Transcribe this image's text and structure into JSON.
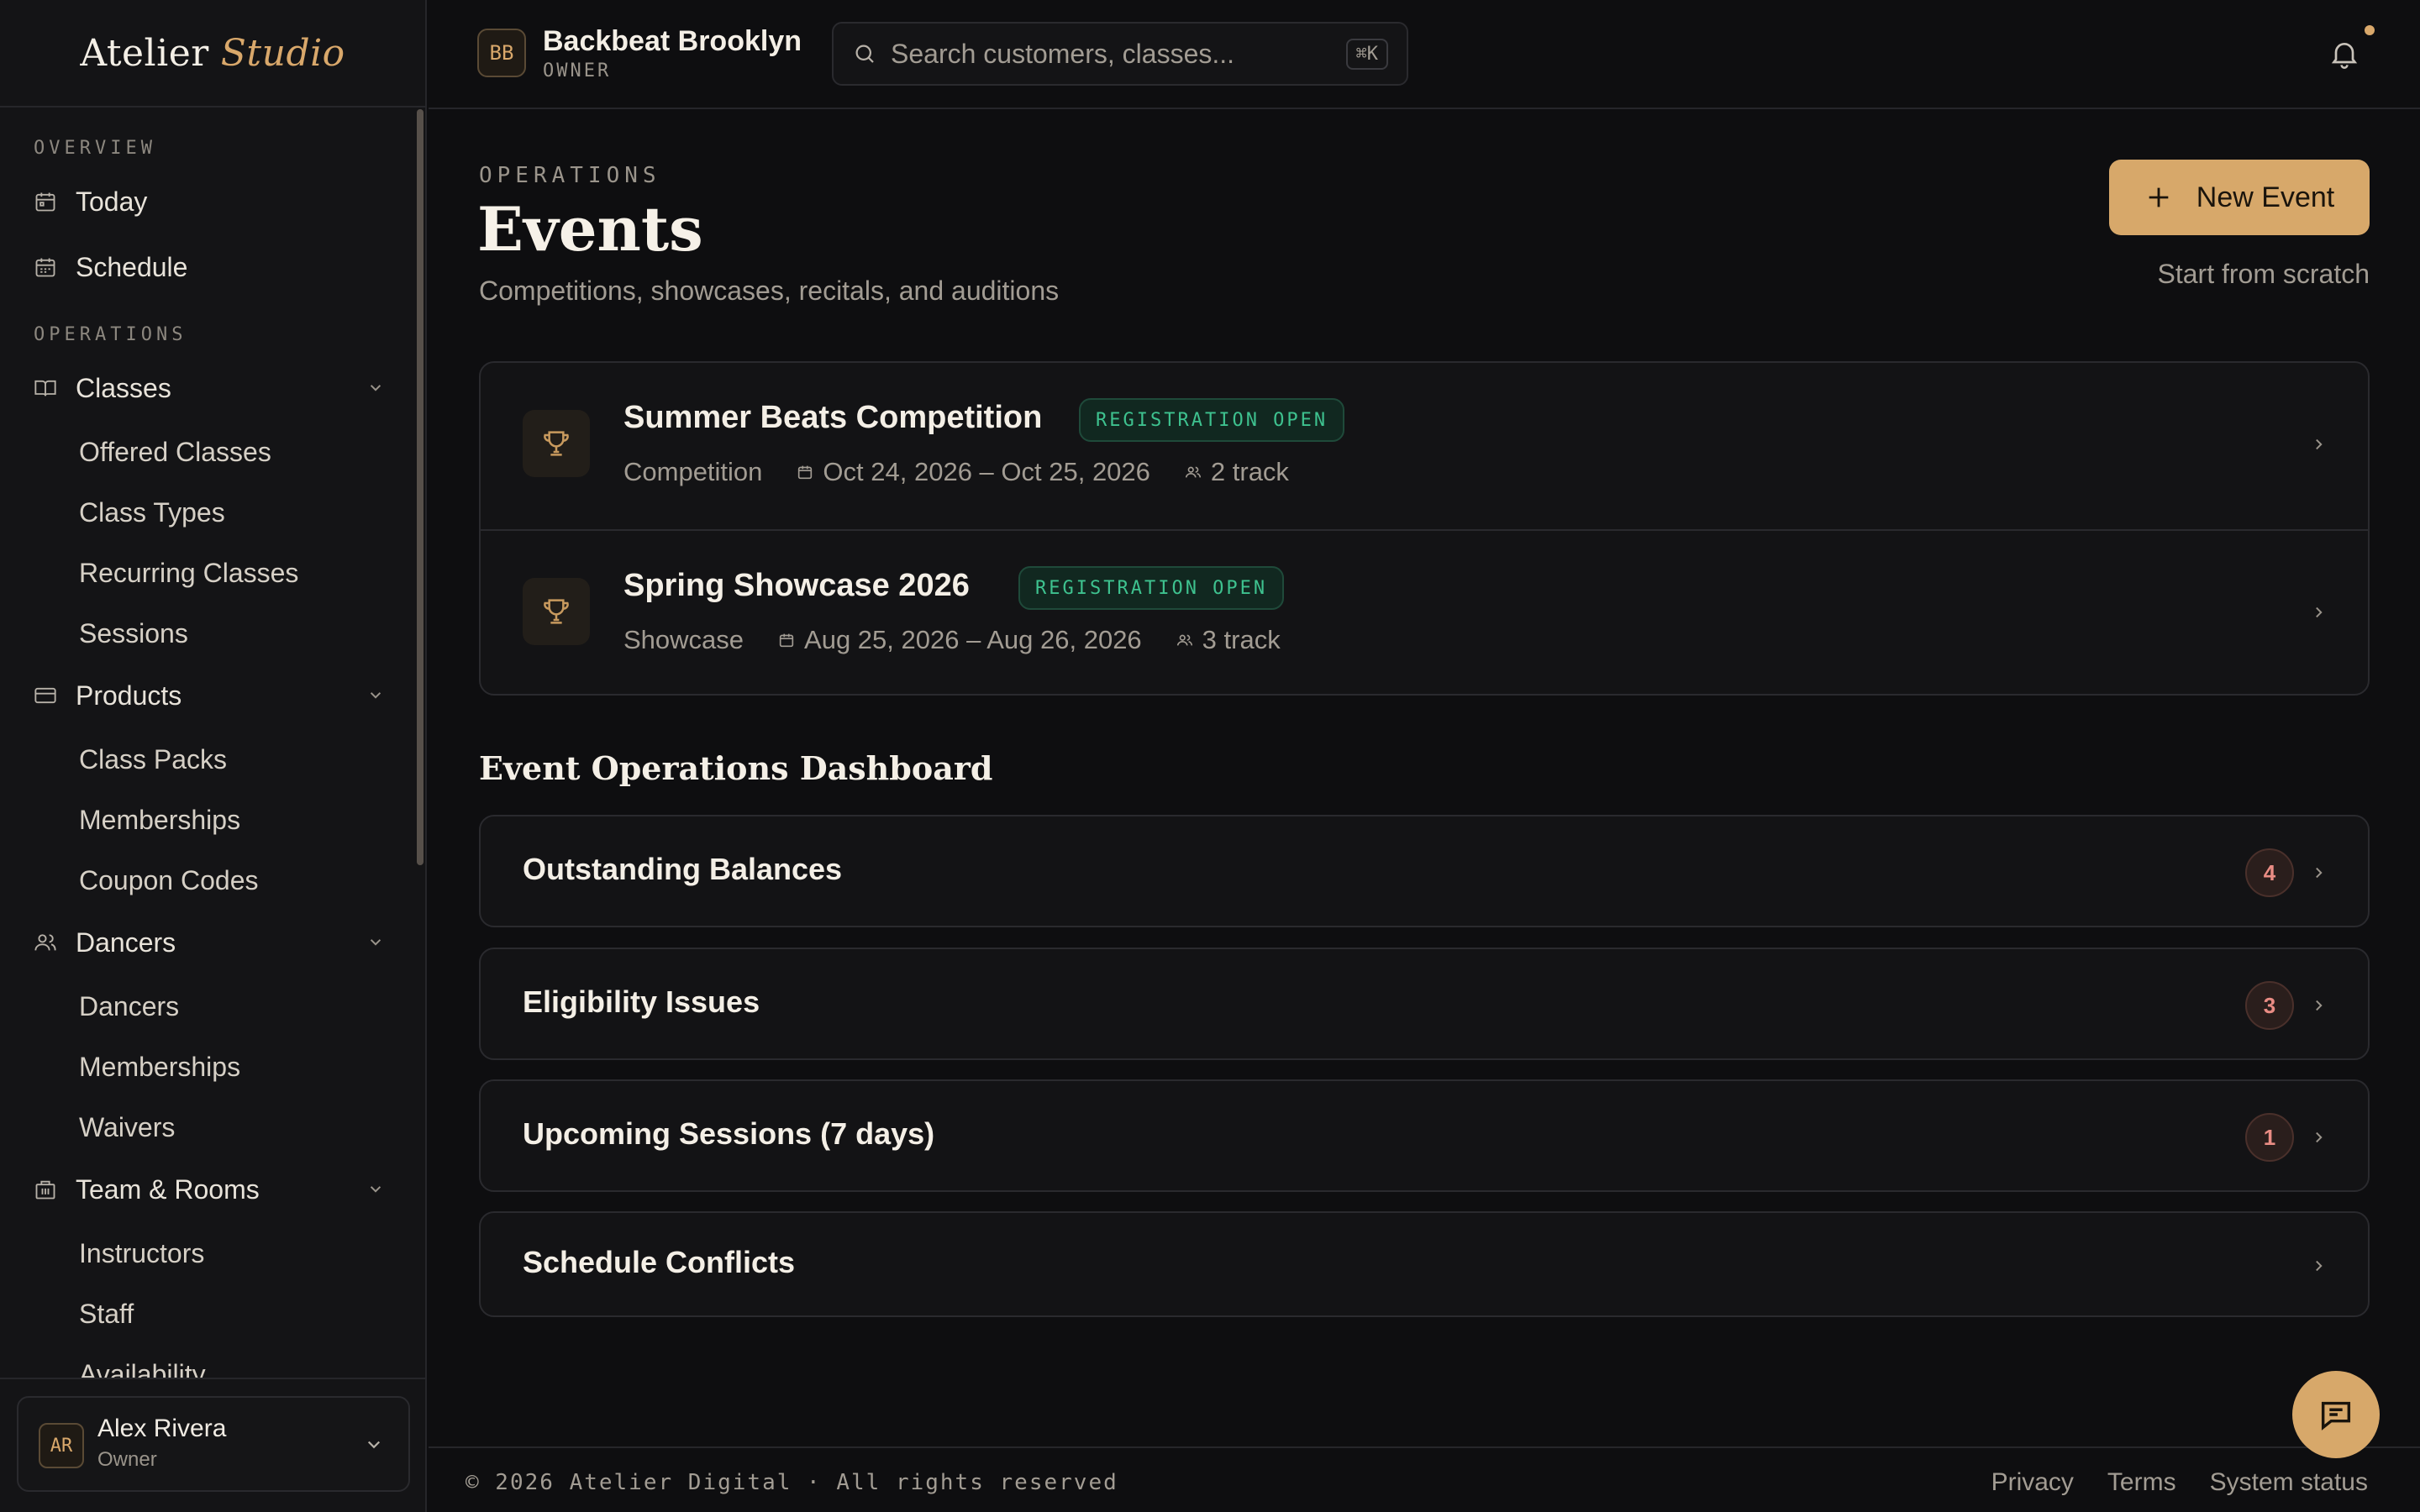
{
  "brand": {
    "name": "Atelier",
    "accent": "Studio"
  },
  "org": {
    "initials": "BB",
    "name": "Backbeat Brooklyn",
    "role": "OWNER"
  },
  "search": {
    "placeholder": "Search customers, classes...",
    "shortcut": "⌘K"
  },
  "sidebar": {
    "sections": {
      "overview": "OVERVIEW",
      "operations": "OPERATIONS"
    },
    "top_items": [
      {
        "label": "Today",
        "icon": "calendar-today-icon"
      },
      {
        "label": "Schedule",
        "icon": "calendar-grid-icon"
      }
    ],
    "groups": [
      {
        "label": "Classes",
        "icon": "book-icon",
        "children": [
          "Offered Classes",
          "Class Types",
          "Recurring Classes",
          "Sessions"
        ]
      },
      {
        "label": "Products",
        "icon": "card-icon",
        "children": [
          "Class Packs",
          "Memberships",
          "Coupon Codes"
        ]
      },
      {
        "label": "Dancers",
        "icon": "users-icon",
        "children": [
          "Dancers",
          "Memberships",
          "Waivers"
        ]
      },
      {
        "label": "Team & Rooms",
        "icon": "building-icon",
        "children": [
          "Instructors",
          "Staff",
          "Availability"
        ]
      }
    ],
    "user": {
      "initials": "AR",
      "name": "Alex Rivera",
      "role": "Owner"
    }
  },
  "page": {
    "eyebrow": "OPERATIONS",
    "title": "Events",
    "subtitle": "Competitions, showcases, recitals, and auditions",
    "new_button": "New Event",
    "new_hint": "Start from scratch"
  },
  "events": [
    {
      "title": "Summer Beats Competition",
      "status": "REGISTRATION OPEN",
      "type": "Competition",
      "dates": "Oct 24, 2026 – Oct 25, 2026",
      "tracks": "2 track"
    },
    {
      "title": "Spring Showcase 2026",
      "status": "REGISTRATION OPEN",
      "type": "Showcase",
      "dates": "Aug 25, 2026 – Aug 26, 2026",
      "tracks": "3 track"
    }
  ],
  "dashboard": {
    "title": "Event Operations Dashboard",
    "cards": [
      {
        "label": "Outstanding Balances",
        "count": "4"
      },
      {
        "label": "Eligibility Issues",
        "count": "3"
      },
      {
        "label": "Upcoming Sessions (7 days)",
        "count": "1"
      },
      {
        "label": "Schedule Conflicts",
        "count": ""
      }
    ]
  },
  "footer": {
    "copyright": "© 2026 Atelier Digital · All rights reserved",
    "links": [
      "Privacy",
      "Terms",
      "System status"
    ]
  },
  "colors": {
    "accent": "#d7a86a",
    "status_green": "#3ec28f",
    "count_red": "#e98c84",
    "background": "#0e0e10"
  }
}
